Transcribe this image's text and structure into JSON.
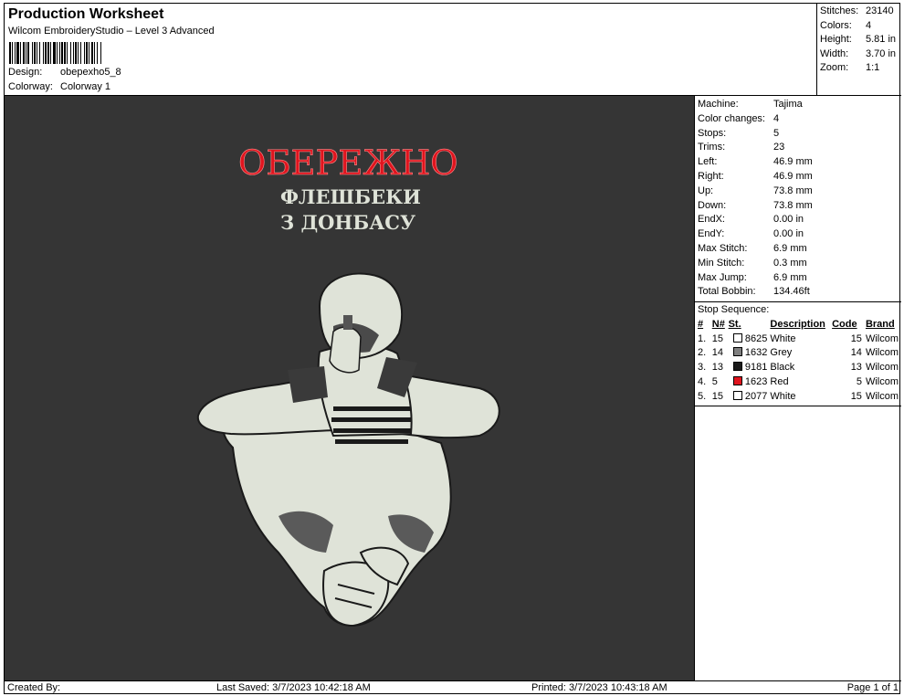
{
  "header": {
    "title": "Production Worksheet",
    "subtitle": "Wilcom EmbroideryStudio – Level 3 Advanced",
    "design_label": "Design:",
    "design_value": "obepexho5_8",
    "colorway_label": "Colorway:",
    "colorway_value": "Colorway 1"
  },
  "stats": [
    {
      "label": "Stitches:",
      "value": "23140"
    },
    {
      "label": "Colors:",
      "value": "4"
    },
    {
      "label": "Height:",
      "value": "5.81 in"
    },
    {
      "label": "Width:",
      "value": "3.70 in"
    },
    {
      "label": "Zoom:",
      "value": "1:1"
    }
  ],
  "machine": [
    {
      "label": "Machine:",
      "value": "Tajima"
    },
    {
      "label": "Color changes:",
      "value": "4"
    },
    {
      "label": "Stops:",
      "value": "5"
    },
    {
      "label": "Trims:",
      "value": "23"
    },
    {
      "label": "Left:",
      "value": "46.9 mm"
    },
    {
      "label": "Right:",
      "value": "46.9 mm"
    },
    {
      "label": "Up:",
      "value": "73.8 mm"
    },
    {
      "label": "Down:",
      "value": "73.8 mm"
    },
    {
      "label": "EndX:",
      "value": "0.00 in"
    },
    {
      "label": "EndY:",
      "value": "0.00 in"
    },
    {
      "label": "Max Stitch:",
      "value": "6.9 mm"
    },
    {
      "label": "Min Stitch:",
      "value": "0.3 mm"
    },
    {
      "label": "Max Jump:",
      "value": "6.9 mm"
    },
    {
      "label": "Total Bobbin:",
      "value": "134.46ft"
    }
  ],
  "stop_sequence": {
    "heading": "Stop Sequence:",
    "columns": [
      "#",
      "N#",
      "St.",
      "Description",
      "Code",
      "Brand"
    ],
    "rows": [
      {
        "num": "1.",
        "n": "15",
        "color": "#ffffff",
        "st": "8625",
        "desc": "White",
        "code": "15",
        "brand": "Wilcom"
      },
      {
        "num": "2.",
        "n": "14",
        "color": "#808080",
        "st": "1632",
        "desc": "Grey",
        "code": "14",
        "brand": "Wilcom"
      },
      {
        "num": "3.",
        "n": "13",
        "color": "#1a1a1a",
        "st": "9181",
        "desc": "Black",
        "code": "13",
        "brand": "Wilcom"
      },
      {
        "num": "4.",
        "n": "5",
        "color": "#e0141e",
        "st": "1623",
        "desc": "Red",
        "code": "5",
        "brand": "Wilcom"
      },
      {
        "num": "5.",
        "n": "15",
        "color": "#ffffff",
        "st": "2077",
        "desc": "White",
        "code": "15",
        "brand": "Wilcom"
      }
    ]
  },
  "design_text": {
    "line1": "ОБЕРЕЖНО",
    "line2": "ФЛЕШБЕКИ",
    "line3": "З ДОНБАСУ"
  },
  "colors": {
    "canvas": "#353535",
    "thread_white": "#dfe3d8",
    "thread_red": "#e0141e"
  },
  "footer": {
    "created": "Created By:",
    "saved": "Last Saved: 3/7/2023 10:42:18 AM",
    "printed": "Printed: 3/7/2023 10:43:18 AM",
    "page": "Page 1 of 1"
  }
}
